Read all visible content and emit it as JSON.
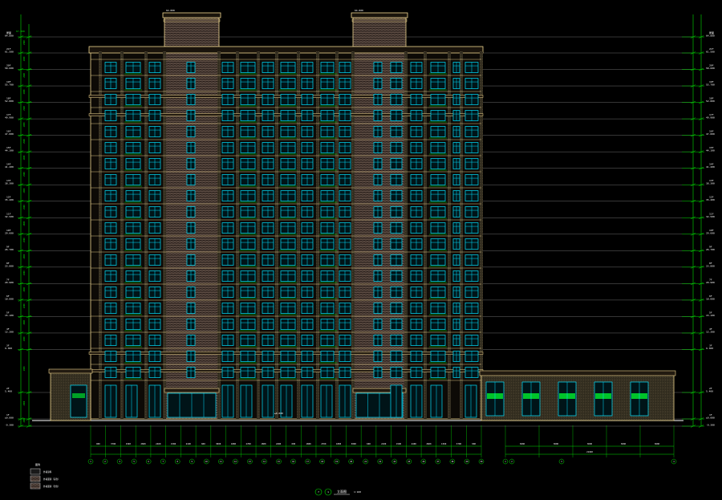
{
  "canvas": {
    "background": "#000000"
  },
  "colors": {
    "dimension": "#00e000",
    "outline": "#f0d890",
    "window": "#00e0ff",
    "masonry": "#a08878",
    "grid": "#9a9a9a",
    "white": "#ffffff",
    "green_panel": "#00ff30",
    "legend_box": "#d0d0d0"
  },
  "drawing_title": {
    "circle_left": "7",
    "circle_right": "1",
    "title": "立面图",
    "scale": "1:100"
  },
  "left_levels": [
    {
      "name": "屋面",
      "value": "64.800"
    },
    {
      "name": "21F",
      "value": "61.500"
    },
    {
      "name": "20F",
      "value": "58.600"
    },
    {
      "name": "19F",
      "value": "55.700"
    },
    {
      "name": "18F",
      "value": "52.800"
    },
    {
      "name": "17F",
      "value": "49.900"
    },
    {
      "name": "16F",
      "value": "47.000"
    },
    {
      "name": "15F",
      "value": "44.100"
    },
    {
      "name": "14F",
      "value": "41.200"
    },
    {
      "name": "13F",
      "value": "38.300"
    },
    {
      "name": "12F",
      "value": "35.400"
    },
    {
      "name": "11F",
      "value": "32.500"
    },
    {
      "name": "10F",
      "value": "29.600"
    },
    {
      "name": "9F",
      "value": "26.700"
    },
    {
      "name": "8F",
      "value": "23.800"
    },
    {
      "name": "7F",
      "value": "20.900"
    },
    {
      "name": "6F",
      "value": "18.000"
    },
    {
      "name": "5F",
      "value": "15.100"
    },
    {
      "name": "4F",
      "value": "12.200"
    },
    {
      "name": "3F",
      "value": "9.300"
    },
    {
      "name": "2F",
      "value": "5.400"
    },
    {
      "name": "1F",
      "value": "±0.000"
    },
    {
      "name": "",
      "value": "-0.300"
    }
  ],
  "right_levels": [
    {
      "name": "屋面",
      "value": "64.800"
    },
    {
      "name": "21F",
      "value": "61.500"
    },
    {
      "name": "20F",
      "value": "58.600"
    },
    {
      "name": "19F",
      "value": "55.700"
    },
    {
      "name": "18F",
      "value": "52.800"
    },
    {
      "name": "17F",
      "value": "49.900"
    },
    {
      "name": "16F",
      "value": "47.000"
    },
    {
      "name": "15F",
      "value": "44.100"
    },
    {
      "name": "14F",
      "value": "41.200"
    },
    {
      "name": "13F",
      "value": "38.300"
    },
    {
      "name": "12F",
      "value": "35.400"
    },
    {
      "name": "11F",
      "value": "32.500"
    },
    {
      "name": "10F",
      "value": "29.600"
    },
    {
      "name": "9F",
      "value": "26.700"
    },
    {
      "name": "8F",
      "value": "23.800"
    },
    {
      "name": "7F",
      "value": "20.900"
    },
    {
      "name": "6F",
      "value": "18.000"
    },
    {
      "name": "5F",
      "value": "15.100"
    },
    {
      "name": "4F",
      "value": "12.200"
    },
    {
      "name": "3F",
      "value": "9.300"
    },
    {
      "name": "2F",
      "value": "5.400"
    },
    {
      "name": "1F",
      "value": "±0.000"
    },
    {
      "name": "",
      "value": "-0.300"
    }
  ],
  "bottom_dims": [
    "900",
    "3700",
    "1500",
    "2600",
    "2400",
    "1500",
    "2100",
    "600",
    "3000",
    "1800",
    "2700",
    "1800",
    "2400",
    "600",
    "1800",
    "2700",
    "1800",
    "3000",
    "600",
    "2100",
    "1500",
    "2400",
    "2600",
    "1500",
    "3700",
    "900"
  ],
  "axis_labels": [
    "1",
    "2",
    "3",
    "5",
    "6",
    "7",
    "8",
    "9",
    "10",
    "11",
    "12",
    "13",
    "14",
    "15",
    "16",
    "17",
    "18",
    "19",
    "20",
    "21",
    "22",
    "24",
    "25",
    "26",
    "27",
    "28",
    "29",
    "30"
  ],
  "annex_dims": [
    "3600",
    "3600",
    "3600",
    "3600",
    "3600"
  ],
  "annex_total": "21600",
  "annex_axes": [
    "1",
    "2",
    "3",
    "4"
  ],
  "legend": {
    "title": "图例",
    "items": [
      {
        "label": "外墙涂料"
      },
      {
        "label": "外墙面砖（深色）"
      },
      {
        "label": "外墙面砖（浅色）"
      }
    ]
  },
  "labels": {
    "top_elev": "67.300",
    "tower_elev": "64.800",
    "mid_elev": "±0.000"
  }
}
